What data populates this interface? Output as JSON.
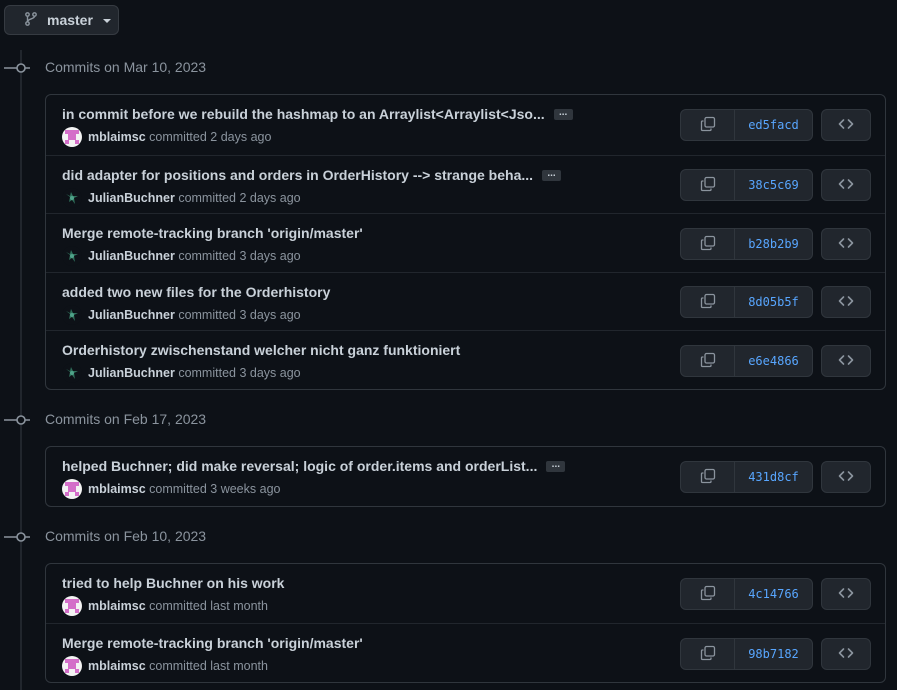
{
  "branch": {
    "name": "master"
  },
  "groups": [
    {
      "header": "Commits on Mar 10, 2023",
      "commits": [
        {
          "title": "in commit before we rebuild the hashmap to an Arraylist<Arraylist<Jso...",
          "truncated": true,
          "author": "mblaimsc",
          "time_text": "committed 2 days ago",
          "sha": "ed5facd",
          "avatar": "pink"
        },
        {
          "title": "did adapter for positions and orders in OrderHistory --> strange beha...",
          "truncated": true,
          "author": "JulianBuchner",
          "time_text": "committed 2 days ago",
          "sha": "38c5c69",
          "avatar": "green"
        },
        {
          "title": "Merge remote-tracking branch 'origin/master'",
          "truncated": false,
          "author": "JulianBuchner",
          "time_text": "committed 3 days ago",
          "sha": "b28b2b9",
          "avatar": "green"
        },
        {
          "title": "added two new files for the Orderhistory",
          "truncated": false,
          "author": "JulianBuchner",
          "time_text": "committed 3 days ago",
          "sha": "8d05b5f",
          "avatar": "green"
        },
        {
          "title": "Orderhistory zwischenstand welcher nicht ganz funktioniert",
          "truncated": false,
          "author": "JulianBuchner",
          "time_text": "committed 3 days ago",
          "sha": "e6e4866",
          "avatar": "green"
        }
      ]
    },
    {
      "header": "Commits on Feb 17, 2023",
      "commits": [
        {
          "title": "helped Buchner; did make reversal; logic of order.items and orderList...",
          "truncated": true,
          "author": "mblaimsc",
          "time_text": "committed 3 weeks ago",
          "sha": "431d8cf",
          "avatar": "pink"
        }
      ]
    },
    {
      "header": "Commits on Feb 10, 2023",
      "commits": [
        {
          "title": "tried to help Buchner on his work",
          "truncated": false,
          "author": "mblaimsc",
          "time_text": "committed last month",
          "sha": "4c14766",
          "avatar": "pink"
        },
        {
          "title": "Merge remote-tracking branch 'origin/master'",
          "truncated": false,
          "author": "mblaimsc",
          "time_text": "committed last month",
          "sha": "98b7182",
          "avatar": "pink"
        }
      ]
    }
  ],
  "ellipsis_label": "...",
  "icons": {
    "branch": "git-branch-icon",
    "commit": "git-commit-icon",
    "copy": "copy-icon",
    "browse": "code-icon"
  },
  "colors": {
    "background": "#0d1117",
    "text": "#c9d1d9",
    "muted": "#8b949e",
    "link": "#58a6ff",
    "button": "#21262d",
    "border": "#30363d"
  }
}
